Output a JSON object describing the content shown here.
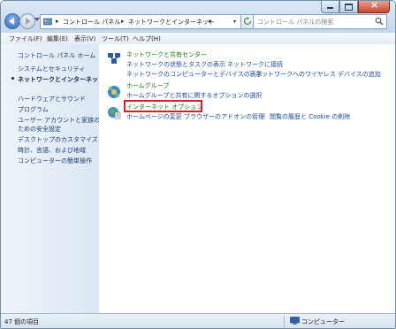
{
  "address": {
    "crumbs": [
      "コントロール パネル",
      "ネットワークとインターネット"
    ],
    "separator": "▸"
  },
  "search": {
    "placeholder": "コントロール パネルの検索"
  },
  "menu": [
    "ファイル(F)",
    "編集(E)",
    "表示(V)",
    "ツール(T)",
    "ヘルプ(H)"
  ],
  "sidebar": {
    "home": "コントロール パネル ホーム",
    "items": [
      "システムとセキュリティ",
      "ネットワークとインターネット",
      "ハードウェアとサウンド",
      "プログラム",
      "ユーザー アカウントと家族の",
      "ための安全設定",
      "デスクトップのカスタマイズ",
      "時計、言語、および地域",
      "コンピューターの簡単操作"
    ]
  },
  "categories": [
    {
      "title": "ネットワークと共有センター",
      "links": [
        "ネットワークの状態とタスクの表示",
        "ネットワークに接続",
        "ネットワークのコンピューターとデバイスの表示",
        "ネットワークへのワイヤレス デバイスの追加"
      ],
      "icon": "network-icon"
    },
    {
      "title": "ホームグループ",
      "links": [
        "ホームグループと共有に関するオプションの選択"
      ],
      "icon": "homegroup-icon"
    },
    {
      "title": "インターネット オプション",
      "links": [
        "ホームページの変更",
        "ブラウザーのアドオンの管理",
        "閲覧の履歴と Cookie の削除"
      ],
      "icon": "internet-options-icon"
    }
  ],
  "link_separator": "|",
  "status": {
    "count": "47 個の項目",
    "location": "コンピューター"
  },
  "colors": {
    "highlight": "#d4202a",
    "category_title": "#1f7a1f",
    "link": "#1a4e9e"
  }
}
